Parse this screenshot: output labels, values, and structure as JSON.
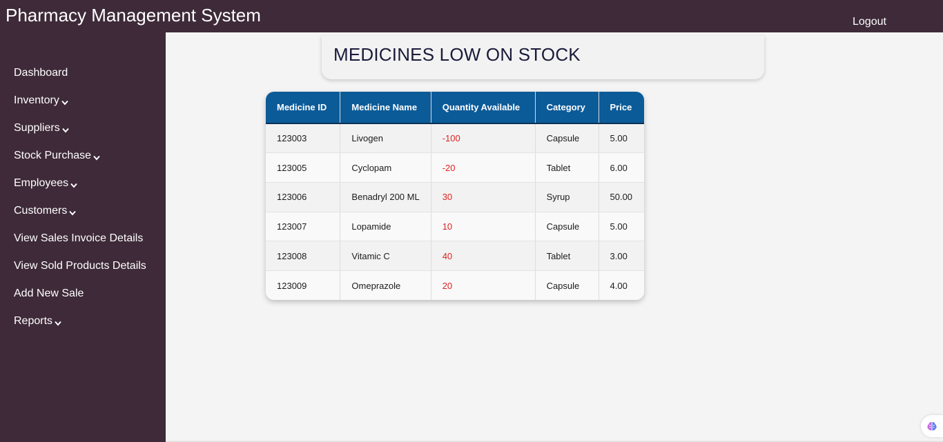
{
  "app": {
    "title": "Pharmacy Management System",
    "logout_label": "Logout"
  },
  "sidebar": {
    "items": [
      {
        "label": "Dashboard",
        "dropdown": false
      },
      {
        "label": "Inventory",
        "dropdown": true
      },
      {
        "label": "Suppliers",
        "dropdown": true
      },
      {
        "label": "Stock Purchase",
        "dropdown": true
      },
      {
        "label": "Employees",
        "dropdown": true
      },
      {
        "label": "Customers",
        "dropdown": true
      },
      {
        "label": "View Sales Invoice Details",
        "dropdown": false
      },
      {
        "label": "View Sold Products Details",
        "dropdown": false
      },
      {
        "label": "Add New Sale",
        "dropdown": false
      },
      {
        "label": "Reports",
        "dropdown": true
      }
    ]
  },
  "page": {
    "title": "MEDICINES LOW ON STOCK"
  },
  "table": {
    "headers": [
      "Medicine ID",
      "Medicine Name",
      "Quantity Available",
      "Category",
      "Price"
    ],
    "rows": [
      [
        "123003",
        "Livogen",
        "-100",
        "Capsule",
        "5.00"
      ],
      [
        "123005",
        "Cyclopam",
        "-20",
        "Tablet",
        "6.00"
      ],
      [
        "123006",
        "Benadryl 200 ML",
        "30",
        "Syrup",
        "50.00"
      ],
      [
        "123007",
        "Lopamide",
        "10",
        "Capsule",
        "5.00"
      ],
      [
        "123008",
        "Vitamic C",
        "40",
        "Tablet",
        "3.00"
      ],
      [
        "123009",
        "Omeprazole",
        "20",
        "Capsule",
        "4.00"
      ]
    ]
  },
  "colors": {
    "sidebar_bg": "#3e2a39",
    "table_header_bg": "#0c5b99",
    "low_stock_text": "#e02020",
    "page_bg": "#f4f4f4"
  },
  "icons": {
    "dropdown": "chevron-down-icon",
    "assistant": "brain-icon"
  }
}
